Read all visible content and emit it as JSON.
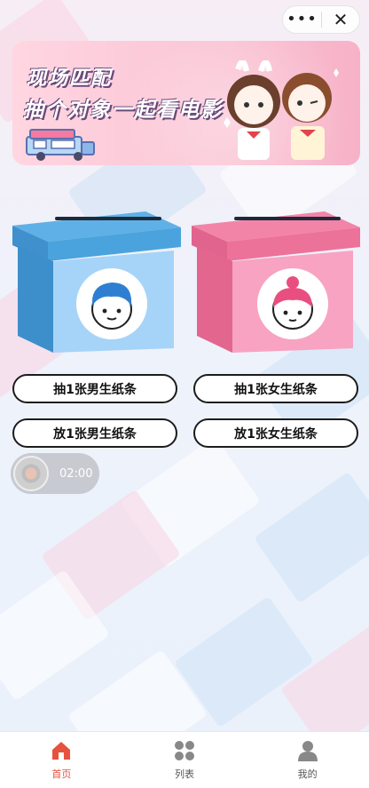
{
  "topbar": {
    "more_icon": "more-dots-icon",
    "close_icon": "close-icon",
    "more_glyph": "•••",
    "close_glyph": "✕"
  },
  "banner": {
    "title_line1": "现场匹配",
    "title_line2": "抽个对象一起看电影"
  },
  "boxes": {
    "male": {
      "color": "#5fb4ea",
      "icon": "boy-avatar-icon"
    },
    "female": {
      "color": "#f07aa0",
      "icon": "girl-avatar-icon"
    }
  },
  "actions": {
    "draw_male": "抽1张男生纸条",
    "draw_female": "抽1张女生纸条",
    "put_male": "放1张男生纸条",
    "put_female": "放1张女生纸条"
  },
  "music": {
    "time": "02:00"
  },
  "tabbar": {
    "items": [
      {
        "label": "首页",
        "icon": "home-icon",
        "active": true
      },
      {
        "label": "列表",
        "icon": "grid-icon",
        "active": false
      },
      {
        "label": "我的",
        "icon": "user-icon",
        "active": false
      }
    ],
    "active_color": "#e5533d"
  }
}
